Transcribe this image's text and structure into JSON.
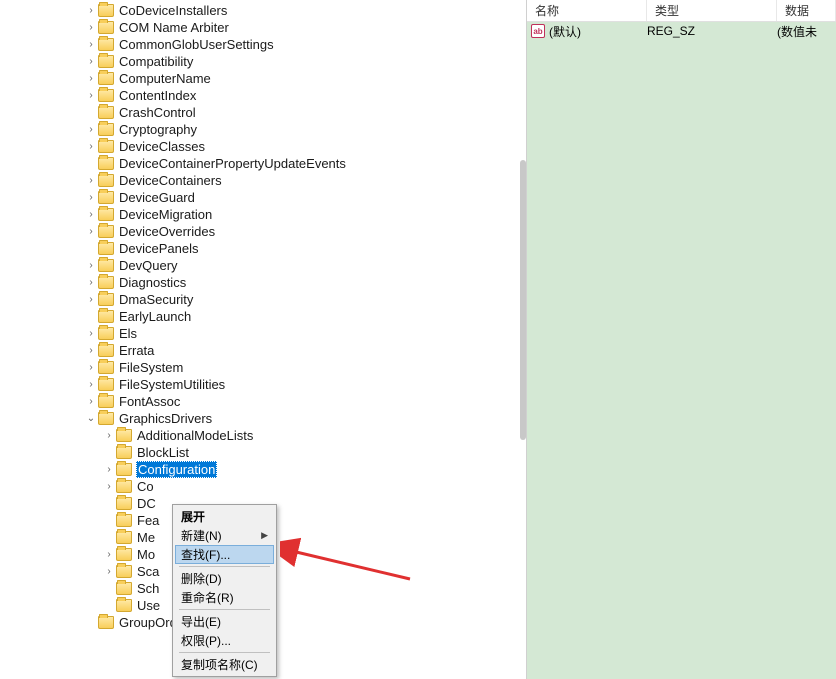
{
  "tree": {
    "baseIndent": 84,
    "items": [
      {
        "label": "CoDeviceInstallers",
        "depth": 0,
        "chev": "closed"
      },
      {
        "label": "COM Name Arbiter",
        "depth": 0,
        "chev": "closed"
      },
      {
        "label": "CommonGlobUserSettings",
        "depth": 0,
        "chev": "closed"
      },
      {
        "label": "Compatibility",
        "depth": 0,
        "chev": "closed"
      },
      {
        "label": "ComputerName",
        "depth": 0,
        "chev": "closed"
      },
      {
        "label": "ContentIndex",
        "depth": 0,
        "chev": "closed"
      },
      {
        "label": "CrashControl",
        "depth": 0,
        "chev": "none"
      },
      {
        "label": "Cryptography",
        "depth": 0,
        "chev": "closed"
      },
      {
        "label": "DeviceClasses",
        "depth": 0,
        "chev": "closed"
      },
      {
        "label": "DeviceContainerPropertyUpdateEvents",
        "depth": 0,
        "chev": "none"
      },
      {
        "label": "DeviceContainers",
        "depth": 0,
        "chev": "closed"
      },
      {
        "label": "DeviceGuard",
        "depth": 0,
        "chev": "closed"
      },
      {
        "label": "DeviceMigration",
        "depth": 0,
        "chev": "closed"
      },
      {
        "label": "DeviceOverrides",
        "depth": 0,
        "chev": "closed"
      },
      {
        "label": "DevicePanels",
        "depth": 0,
        "chev": "none"
      },
      {
        "label": "DevQuery",
        "depth": 0,
        "chev": "closed"
      },
      {
        "label": "Diagnostics",
        "depth": 0,
        "chev": "closed"
      },
      {
        "label": "DmaSecurity",
        "depth": 0,
        "chev": "closed"
      },
      {
        "label": "EarlyLaunch",
        "depth": 0,
        "chev": "none"
      },
      {
        "label": "Els",
        "depth": 0,
        "chev": "closed"
      },
      {
        "label": "Errata",
        "depth": 0,
        "chev": "closed"
      },
      {
        "label": "FileSystem",
        "depth": 0,
        "chev": "closed"
      },
      {
        "label": "FileSystemUtilities",
        "depth": 0,
        "chev": "closed"
      },
      {
        "label": "FontAssoc",
        "depth": 0,
        "chev": "closed"
      },
      {
        "label": "GraphicsDrivers",
        "depth": 0,
        "chev": "open"
      },
      {
        "label": "AdditionalModeLists",
        "depth": 1,
        "chev": "closed"
      },
      {
        "label": "BlockList",
        "depth": 1,
        "chev": "none"
      },
      {
        "label": "Configuration",
        "depth": 1,
        "chev": "closed",
        "selected": true
      },
      {
        "label": "Co",
        "depth": 1,
        "chev": "closed"
      },
      {
        "label": "DC",
        "depth": 1,
        "chev": "none"
      },
      {
        "label": "Fea",
        "depth": 1,
        "chev": "none"
      },
      {
        "label": "Me",
        "depth": 1,
        "chev": "none"
      },
      {
        "label": "Mo",
        "depth": 1,
        "chev": "closed"
      },
      {
        "label": "Sca",
        "depth": 1,
        "chev": "closed"
      },
      {
        "label": "Sch",
        "depth": 1,
        "chev": "none"
      },
      {
        "label": "Use",
        "depth": 1,
        "chev": "none"
      },
      {
        "label": "GroupOrderList",
        "depth": 0,
        "chev": "none"
      }
    ]
  },
  "right": {
    "headers": {
      "name": "名称",
      "type": "类型",
      "data": "数据"
    },
    "row": {
      "name": "(默认)",
      "type": "REG_SZ",
      "data": "(数值未"
    }
  },
  "menu": {
    "items": [
      {
        "label": "展开",
        "bold": true
      },
      {
        "label": "新建(N)",
        "submenu": true
      },
      {
        "label": "查找(F)...",
        "highlight": true
      },
      {
        "sep": true
      },
      {
        "label": "删除(D)"
      },
      {
        "label": "重命名(R)"
      },
      {
        "sep": true
      },
      {
        "label": "导出(E)"
      },
      {
        "label": "权限(P)..."
      },
      {
        "sep": true
      },
      {
        "label": "复制项名称(C)"
      }
    ]
  }
}
